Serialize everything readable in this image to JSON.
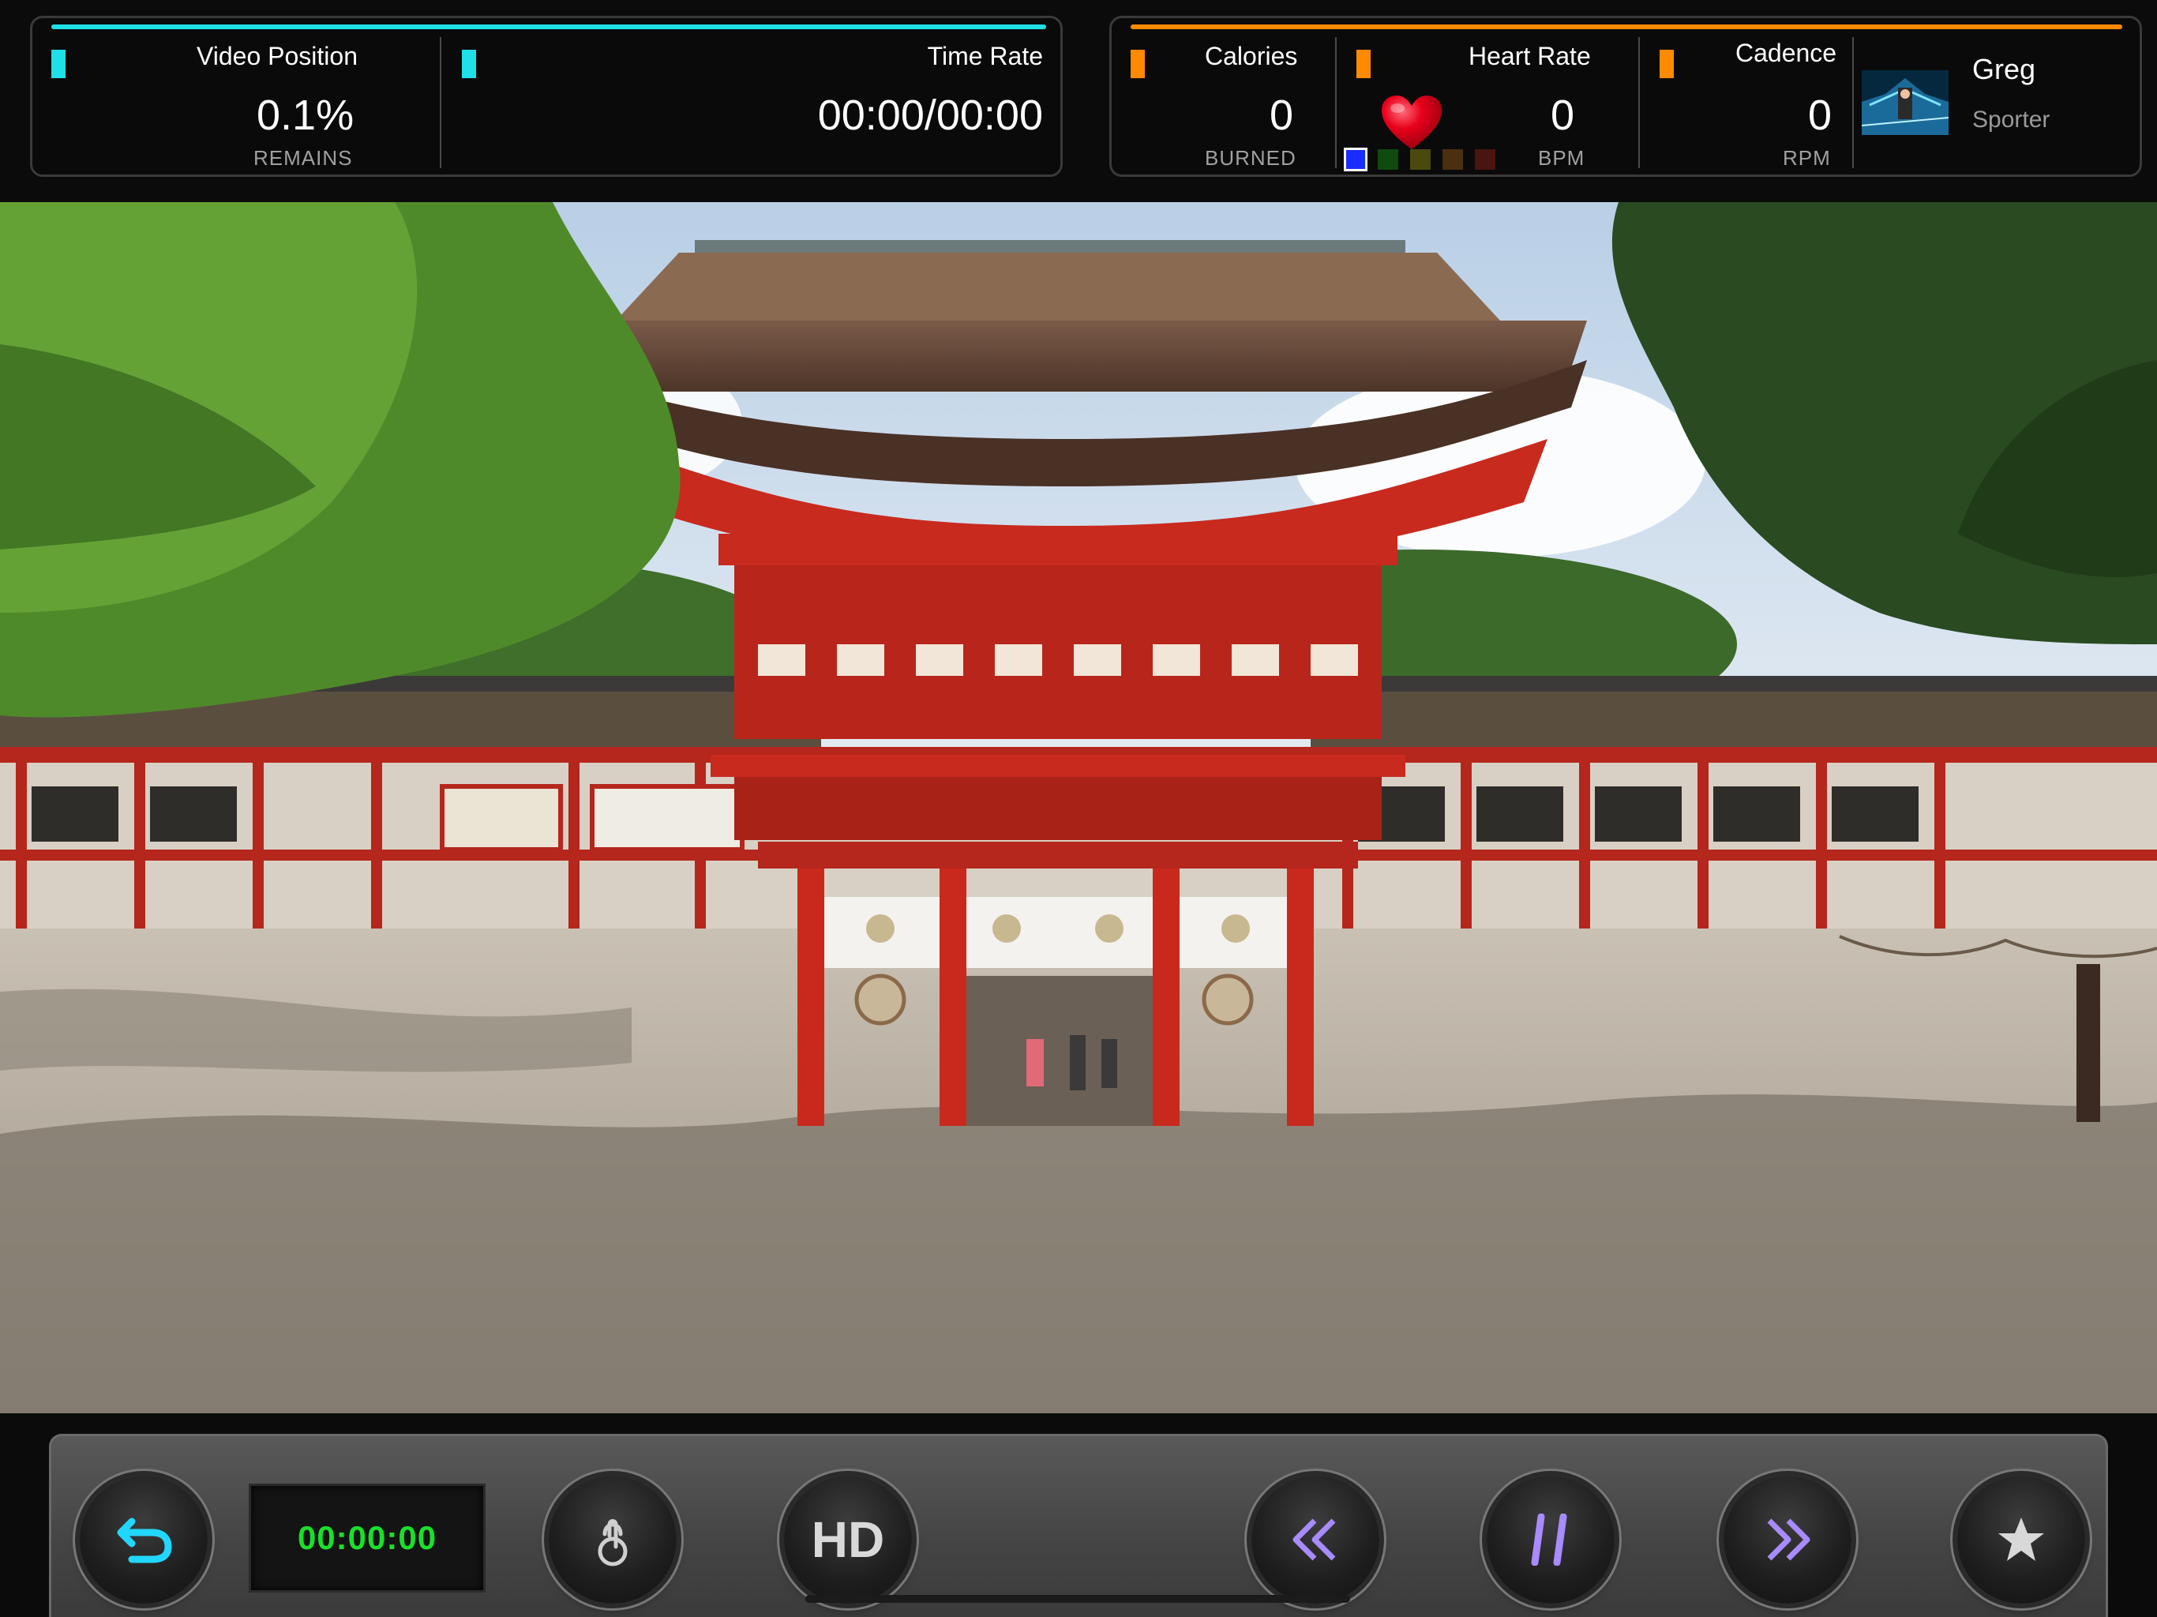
{
  "video_panel": {
    "position_label": "Video Position",
    "position_value": "0.1%",
    "position_sub": "REMAINS",
    "time_label": "Time Rate",
    "time_value": "00:00/00:00"
  },
  "stats_panel": {
    "calories_label": "Calories",
    "calories_value": "0",
    "calories_sub": "BURNED",
    "heart_label": "Heart Rate",
    "heart_value": "0",
    "heart_sub": "BPM",
    "heart_zones": [
      "#1a2cff",
      "#0f4a0f",
      "#4a4a0f",
      "#4a300f",
      "#4a140f"
    ],
    "cadence_label": "Cadence",
    "cadence_value": "0",
    "cadence_sub": "RPM"
  },
  "user": {
    "name": "Greg",
    "role": "Sporter"
  },
  "controls": {
    "timer": "00:00:00",
    "hd_label": "HD",
    "icons": [
      "back-icon",
      "touch-icon",
      "hd-icon",
      "rewind-icon",
      "pause-icon",
      "fast-forward-icon",
      "star-icon"
    ]
  },
  "colors": {
    "cyan_accent": "#1fe0e6",
    "orange_accent": "#ff8a00",
    "timer_green": "#19e02a",
    "heart_red": "#e8001a",
    "playback_purple": "#a78bff"
  }
}
